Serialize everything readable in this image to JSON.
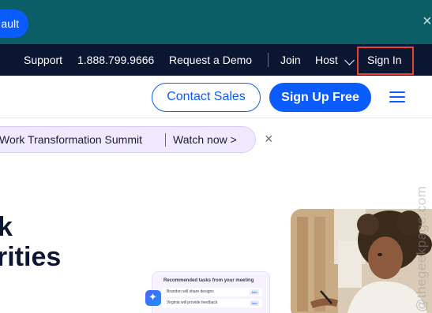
{
  "banner": {
    "button_label": "ault",
    "close_glyph": "×"
  },
  "utility_nav": {
    "support": "Support",
    "phone": "1.888.799.9666",
    "request_demo": "Request a Demo",
    "join": "Join",
    "host": "Host",
    "sign_in": "Sign In"
  },
  "header": {
    "contact_sales": "Contact Sales",
    "sign_up": "Sign Up Free",
    "menu_icon": "hamburger-icon"
  },
  "announcement": {
    "text": "Work Transformation Summit",
    "link": "Watch now >",
    "close_glyph": "×"
  },
  "hero": {
    "line1": "k",
    "line2": "rities"
  },
  "tasks_card": {
    "title": "Recommended tasks from your meeting",
    "items": [
      {
        "text": "Brandon will share designs",
        "action": "Add"
      },
      {
        "text": "Virginia will provide feedback",
        "action": "Add"
      }
    ]
  },
  "watermark": "@thegeekpage.com",
  "colors": {
    "banner": "#0b5d66",
    "utility_bar": "#0b1633",
    "brand_blue": "#0b5cff",
    "highlight_box": "#e8412f",
    "pill_bg": "#efeaff"
  }
}
